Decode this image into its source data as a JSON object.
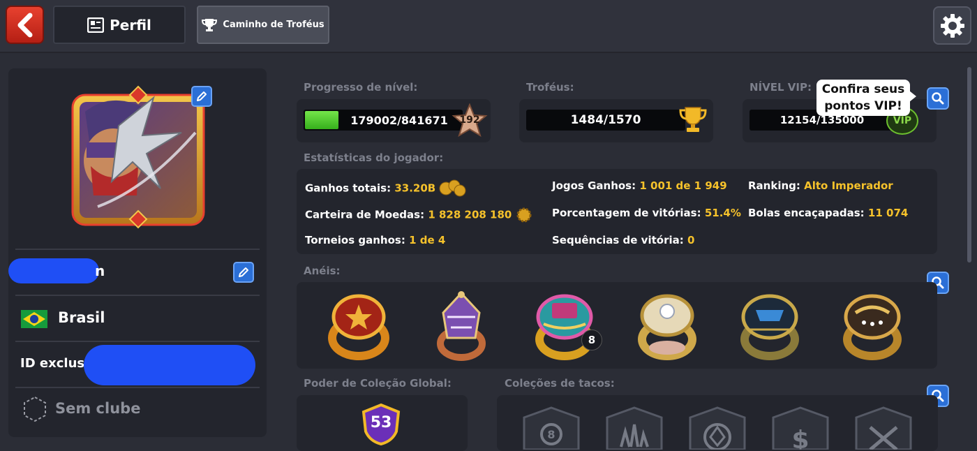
{
  "header": {
    "perfil_label": "Perfil",
    "trophy_path_label": "Caminho de Troféus"
  },
  "profile": {
    "country": "Brasil",
    "id_label": "ID exclusi",
    "club": "Sem clube",
    "username_suffix": "n"
  },
  "level": {
    "title": "Progresso de nível:",
    "progress": "179002/841671",
    "progress_fraction": 0.2127,
    "level": "192"
  },
  "trophies": {
    "title": "Troféus:",
    "value": "1484/1570"
  },
  "vip": {
    "title": "NÍVEL VIP:",
    "value": "12154/135000",
    "badge": "VIP",
    "tooltip_line1": "Confira seus",
    "tooltip_line2": "pontos VIP!"
  },
  "stats": {
    "title": "Estatísticas do jogador:",
    "items": [
      {
        "label": "Ganhos totais:",
        "value": "33.20B"
      },
      {
        "label": "Jogos Ganhos:",
        "value": "1 001 de 1 949"
      },
      {
        "label": "Ranking:",
        "value": "Alto Imperador"
      },
      {
        "label": "Carteira de Moedas:",
        "value": "1 828 208 180"
      },
      {
        "label": "Porcentagem de vitórias:",
        "value": "51.4%"
      },
      {
        "label": "Bolas encaçapadas:",
        "value": "11 074"
      },
      {
        "label": "Torneios ganhos:",
        "value": "1 de 4"
      },
      {
        "label": "Sequências de vitória:",
        "value": "0"
      }
    ]
  },
  "rings": {
    "title": "Anéis:",
    "count_badge": "8"
  },
  "collection": {
    "title": "Poder de Coleção Global:",
    "power": "53",
    "cues_title": "Coleções de tacos:"
  },
  "colors": {
    "background": "#2b2d36",
    "accent_gold": "#f6c22b",
    "progress_green": "#4fd12e",
    "back_red": "#d9321f",
    "button_blue": "#2b6fd6"
  }
}
